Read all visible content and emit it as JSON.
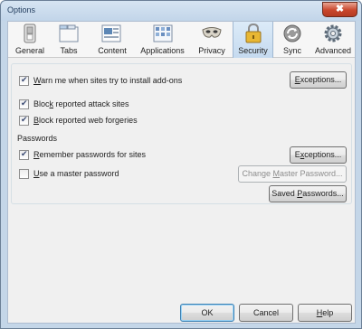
{
  "window": {
    "title": "Options",
    "close_glyph": "✖"
  },
  "panes": [
    {
      "label": "General",
      "icon": "general-switch-icon",
      "active": false
    },
    {
      "label": "Tabs",
      "icon": "tabs-icon",
      "active": false
    },
    {
      "label": "Content",
      "icon": "content-icon",
      "active": false
    },
    {
      "label": "Applications",
      "icon": "applications-icon",
      "active": false
    },
    {
      "label": "Privacy",
      "icon": "privacy-mask-icon",
      "active": false
    },
    {
      "label": "Security",
      "icon": "padlock-icon",
      "active": true
    },
    {
      "label": "Sync",
      "icon": "sync-icon",
      "active": false
    },
    {
      "label": "Advanced",
      "icon": "advanced-gear-icon",
      "active": false
    }
  ],
  "security": {
    "warn_addons": {
      "label_u": "W",
      "label_rest": "arn me when sites try to install add-ons",
      "checked": true
    },
    "exceptions_1": {
      "label_u": "E",
      "label_rest": "xceptions..."
    },
    "block_attack": {
      "label_u": "k",
      "label_pre": "Bloc",
      "label_rest": " reported attack sites",
      "checked": true
    },
    "block_forgeries": {
      "label_u": "B",
      "label_rest": "lock reported web forgeries",
      "checked": true
    }
  },
  "passwords": {
    "header": "Passwords",
    "remember": {
      "label_u": "R",
      "label_rest": "emember passwords for sites",
      "checked": true
    },
    "exceptions_2": {
      "label_pre": "E",
      "label_u": "x",
      "label_rest": "ceptions..."
    },
    "master": {
      "label_u": "U",
      "label_rest": "se a master password",
      "checked": false
    },
    "change_master": {
      "label_pre": "Change ",
      "label_u": "M",
      "label_rest": "aster Password..."
    },
    "saved": {
      "label_pre": "Saved ",
      "label_u": "P",
      "label_rest": "asswords..."
    }
  },
  "footer": {
    "ok": "OK",
    "cancel": "Cancel",
    "help_u": "H",
    "help_rest": "elp"
  },
  "colors": {
    "titlebar": "#c4d6e8",
    "active_pane": "#c5daef",
    "close": "#c9462c"
  }
}
